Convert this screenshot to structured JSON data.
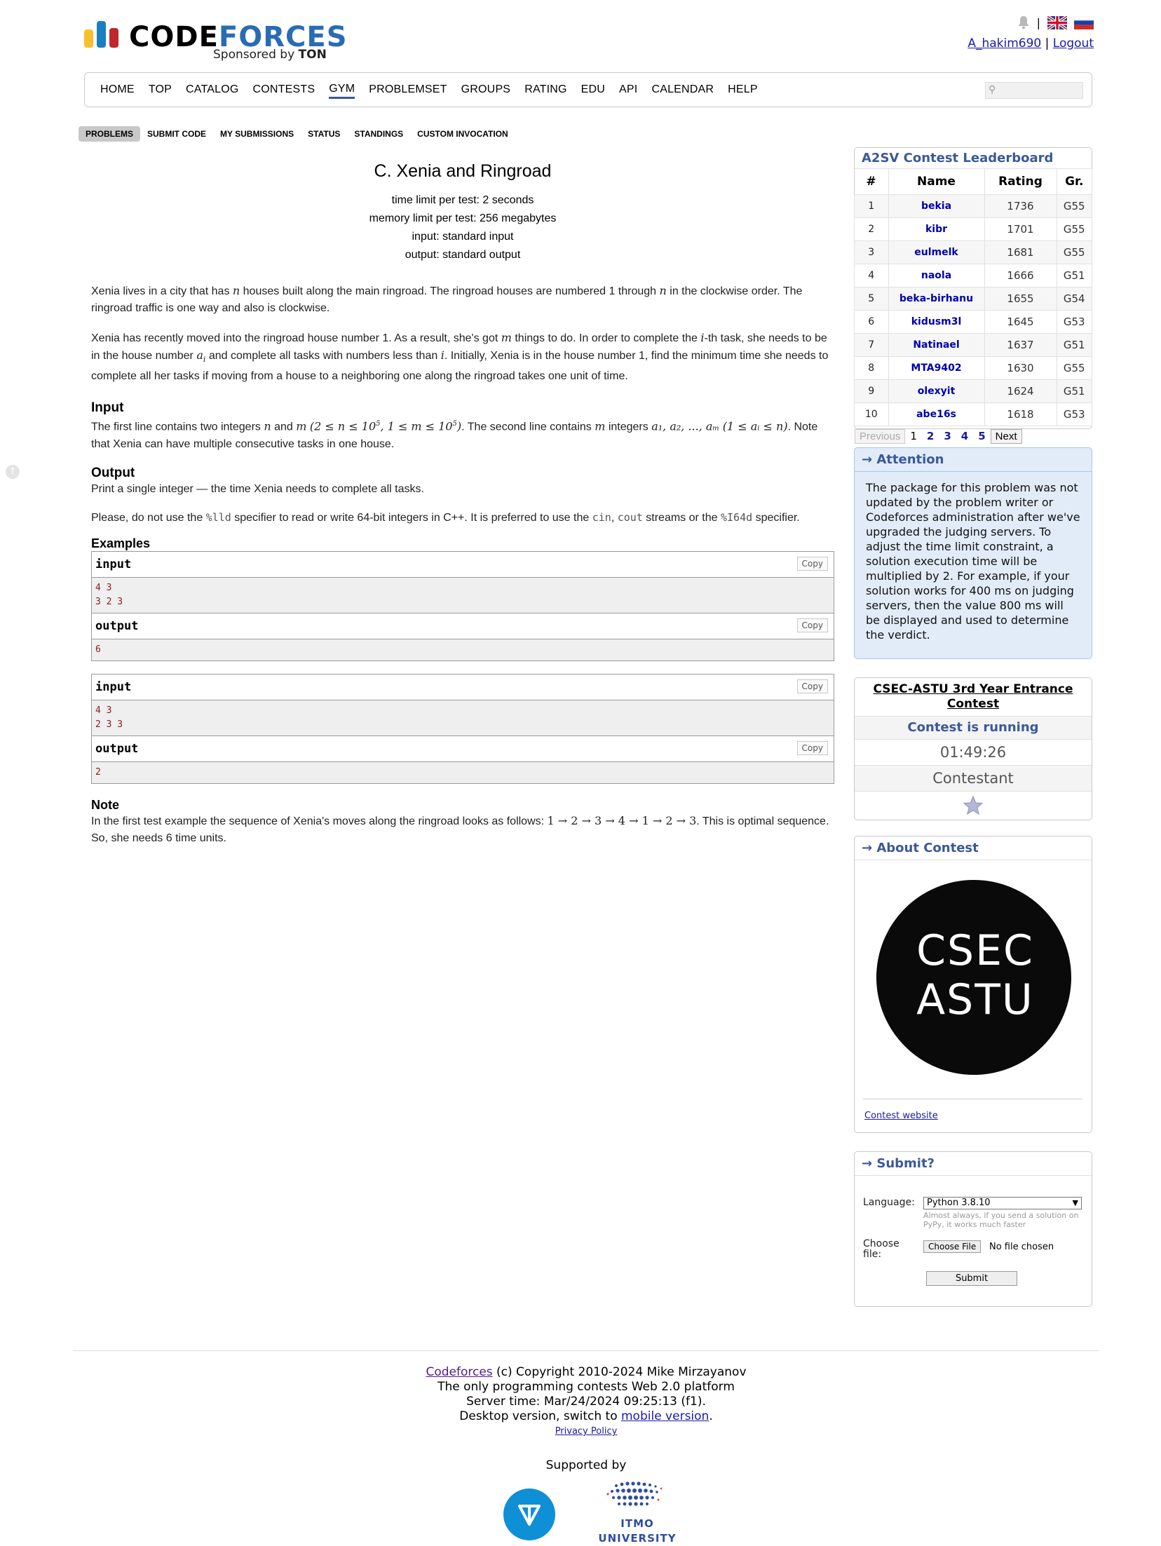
{
  "brand": {
    "logo_code": "CODE",
    "logo_forces": "FORCES",
    "sponsored_by": "Sponsored by",
    "sponsor": "TON",
    "colors": {
      "yellow": "#f7c12d",
      "blue": "#1a7fbf",
      "red": "#c0262d",
      "logo_blue": "#2a6cb4"
    }
  },
  "header": {
    "username": "A_hakim690",
    "separator": "|",
    "logout": "Logout",
    "icons": [
      "bell-icon",
      "uk-flag-icon",
      "russia-flag-icon"
    ]
  },
  "nav": {
    "items": [
      "HOME",
      "TOP",
      "CATALOG",
      "CONTESTS",
      "GYM",
      "PROBLEMSET",
      "GROUPS",
      "RATING",
      "EDU",
      "API",
      "CALENDAR",
      "HELP"
    ],
    "active": "GYM"
  },
  "subnav": {
    "items": [
      "PROBLEMS",
      "SUBMIT CODE",
      "MY SUBMISSIONS",
      "STATUS",
      "STANDINGS",
      "CUSTOM INVOCATION"
    ],
    "active": "PROBLEMS"
  },
  "problem": {
    "title": "C. Xenia and Ringroad",
    "time_limit": "time limit per test: 2 seconds",
    "memory_limit": "memory limit per test: 256 megabytes",
    "input_file": "input: standard input",
    "output_file": "output: standard output",
    "legend_1a": "Xenia lives in a city that has ",
    "legend_1b": " houses built along the main ringroad. The ringroad houses are numbered 1 through ",
    "legend_1c": " in the clockwise order. The ringroad traffic is one way and also is clockwise.",
    "legend_2a": "Xenia has recently moved into the ringroad house number 1. As a result, she's got ",
    "legend_2b": " things to do. In order to complete the ",
    "legend_2c": "-th task, she needs to be in the house number ",
    "legend_2d": " and complete all tasks with numbers less than ",
    "legend_2e": ". Initially, Xenia is in the house number 1, find the minimum time she needs to complete all her tasks if moving from a house to a neighboring one along the ringroad takes one unit of time.",
    "var_n": "n",
    "var_m": "m",
    "var_i": "i",
    "var_ai": "a",
    "var_ai_sub": "i",
    "input_title": "Input",
    "input_1a": "The first line contains two integers ",
    "input_1b": " and ",
    "input_constraints_1": "(2 ≤ n ≤ 10",
    "input_constraints_2": ", 1 ≤ m ≤ 10",
    "input_constraints_3": ")",
    "sup_5": "5",
    "input_1c": ". The second line contains ",
    "input_1d": " integers ",
    "input_seq": "a₁, a₂, ..., aₘ",
    "input_constraints_4": "(1 ≤ aᵢ ≤ n)",
    "input_1e": ". Note that Xenia can have multiple consecutive tasks in one house.",
    "output_title": "Output",
    "output_text": "Print a single integer — the time Xenia needs to complete all tasks.",
    "warn_a": "Please, do not use the ",
    "warn_lld": "%lld",
    "warn_b": " specifier to read or write 64-bit integers in C++. It is preferred to use the ",
    "warn_cin": "cin",
    "warn_comma": ", ",
    "warn_cout": "cout",
    "warn_c": " streams or the ",
    "warn_i64d": "%I64d",
    "warn_d": " specifier.",
    "examples_title": "Examples",
    "copy_label": "Copy",
    "input_label": "input",
    "output_label": "output",
    "examples": [
      {
        "input_line1": "4 3",
        "input_line2": "3 2 3",
        "output": "6"
      },
      {
        "input_line1": "4 3",
        "input_line2": "2 3 3",
        "output": "2"
      }
    ],
    "note_title": "Note",
    "note_a": "In the first test example the sequence of Xenia's moves along the ringroad looks as follows: ",
    "note_seq": "1 → 2 → 3 → 4 → 1 → 2 → 3",
    "note_b": ". This is optimal sequence. So, she needs 6 time units."
  },
  "leaderboard": {
    "title": "A2SV Contest Leaderboard",
    "headers": [
      "#",
      "Name",
      "Rating",
      "Gr."
    ],
    "rows": [
      [
        "1",
        "bekia",
        "1736",
        "G55"
      ],
      [
        "2",
        "kibr",
        "1701",
        "G55"
      ],
      [
        "3",
        "eulmelk",
        "1681",
        "G55"
      ],
      [
        "4",
        "naola",
        "1666",
        "G51"
      ],
      [
        "5",
        "beka-birhanu",
        "1655",
        "G54"
      ],
      [
        "6",
        "kidusm3l",
        "1645",
        "G53"
      ],
      [
        "7",
        "Natinael",
        "1637",
        "G51"
      ],
      [
        "8",
        "MTA9402",
        "1630",
        "G55"
      ],
      [
        "9",
        "olexyit",
        "1624",
        "G51"
      ],
      [
        "10",
        "abe16s",
        "1618",
        "G53"
      ]
    ],
    "previous": "Previous",
    "pages": [
      "1",
      "2",
      "3",
      "4",
      "5"
    ],
    "next": "Next"
  },
  "attention": {
    "title": "→ Attention",
    "text": "The package for this problem was not updated by the problem writer or Codeforces administration after we've upgraded the judging servers. To adjust the time limit constraint, a solution execution time will be multiplied by 2. For example, if your solution works for 400 ms on judging servers, then the value 800 ms will be displayed and used to determine the verdict."
  },
  "contest": {
    "name": "CSEC-ASTU 3rd Year Entrance Contest",
    "state": "Contest is running",
    "timer": "01:49:26",
    "role": "Contestant"
  },
  "about": {
    "title": "→ About Contest",
    "logo_line1": "CSEC",
    "logo_line2": "ASTU",
    "website": "Contest website"
  },
  "submit": {
    "title": "→ Submit?",
    "language_label": "Language:",
    "language_value": "Python 3.8.10",
    "language_hint": "Almost always, if you send a solution on PyPy, it works much faster",
    "file_label": "Choose file:",
    "choose_file": "Choose File",
    "no_file": "No file chosen",
    "submit_button": "Submit"
  },
  "footer": {
    "codeforces": "Codeforces",
    "copyright": " (c) Copyright 2010-2024 Mike Mirzayanov",
    "tagline": "The only programming contests Web 2.0 platform",
    "server_time": "Server time: Mar/24/2024 09:25:13 (f1).",
    "desktop_a": "Desktop version, switch to ",
    "mobile": "mobile version",
    "desktop_b": ".",
    "privacy": "Privacy Policy",
    "supported_by": "Supported by",
    "itmo": "ITMO UNIVERSITY",
    "ton_color": "#0f8fd6",
    "itmo_color": "#2e4da2"
  }
}
